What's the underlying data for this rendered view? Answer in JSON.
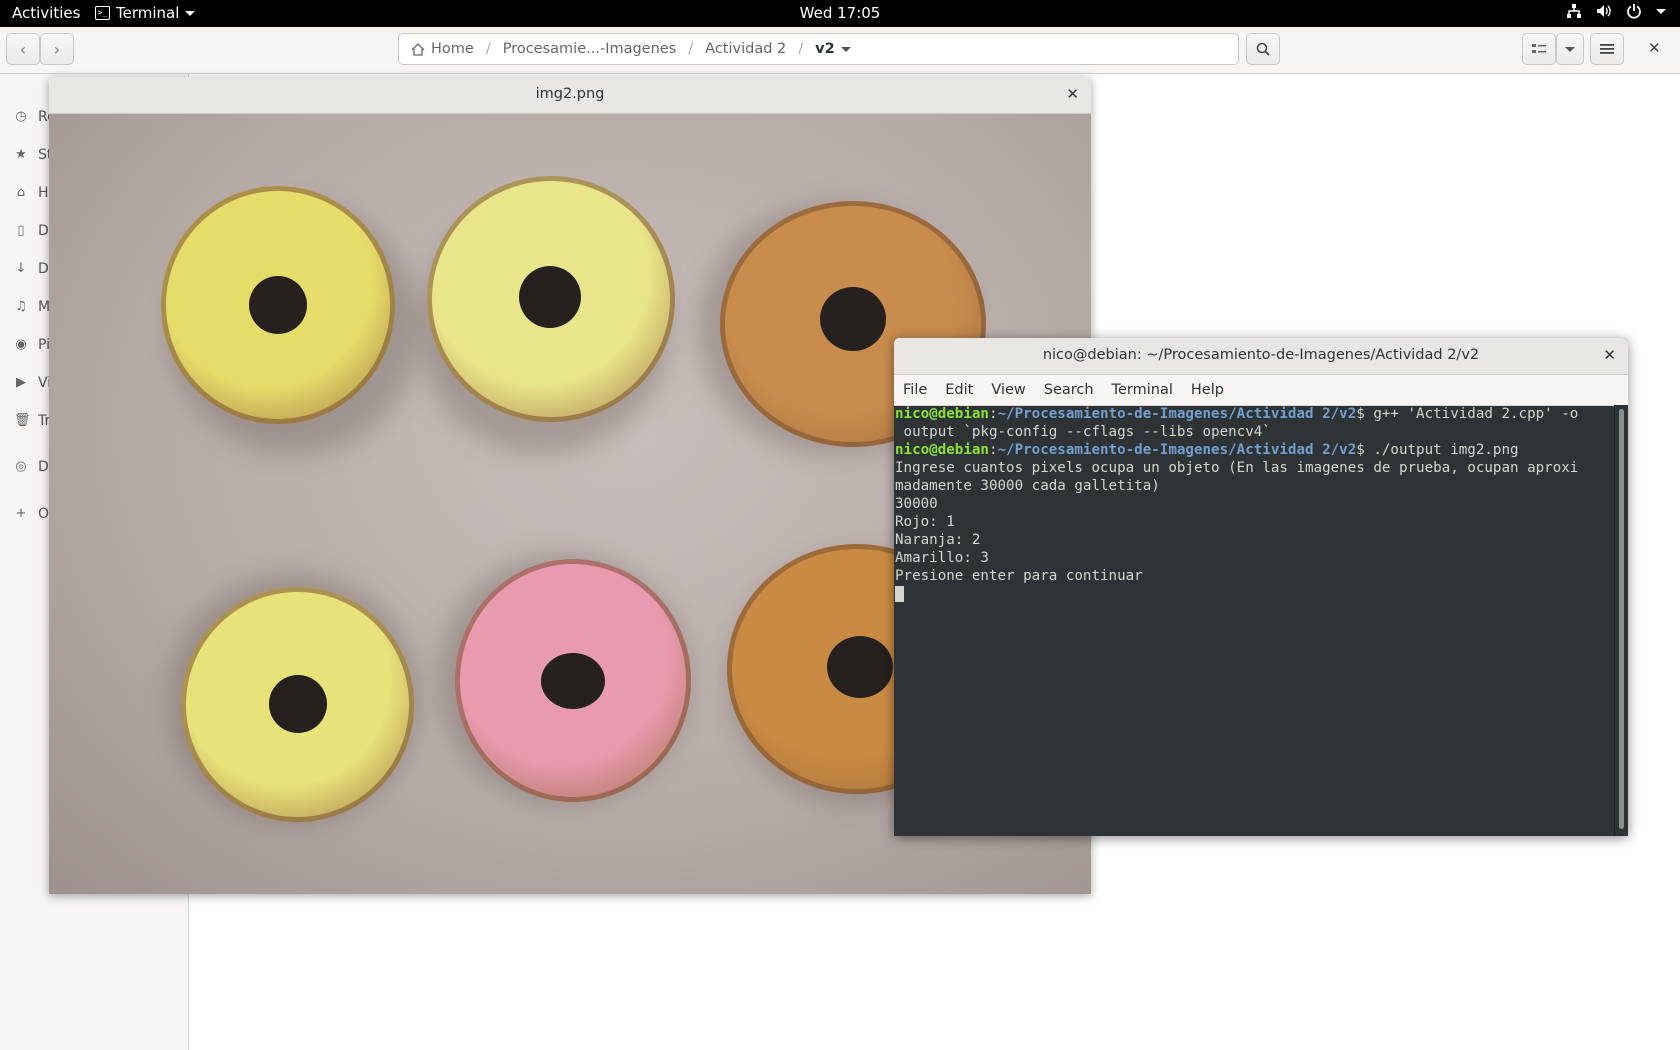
{
  "topbar": {
    "activities": "Activities",
    "app_name": "Terminal",
    "clock": "Wed 17:05"
  },
  "files": {
    "path": [
      "Home",
      "Procesamie...-Imagenes",
      "Actividad 2",
      "v2"
    ],
    "sidebar_items": [
      {
        "label": "Re",
        "icon": "clock-icon"
      },
      {
        "label": "St",
        "icon": "star-icon"
      },
      {
        "label": "H",
        "icon": "home-icon"
      },
      {
        "label": "D",
        "icon": "document-icon"
      },
      {
        "label": "D",
        "icon": "download-icon"
      },
      {
        "label": "M",
        "icon": "music-icon"
      },
      {
        "label": "Pi",
        "icon": "camera-icon"
      },
      {
        "label": "Vi",
        "icon": "video-icon"
      },
      {
        "label": "Tr",
        "icon": "trash-icon"
      },
      {
        "label": "D",
        "icon": "disc-icon"
      },
      {
        "label": "O",
        "icon": "plus-icon"
      }
    ]
  },
  "viewer": {
    "title": "img2.png",
    "donuts": [
      {
        "color": "#e6dc6a"
      },
      {
        "color": "#e9e58a"
      },
      {
        "color": "#c88c4c"
      },
      {
        "color": "#e8e27a"
      },
      {
        "color": "#e89aae"
      },
      {
        "color": "#c98a43"
      }
    ]
  },
  "terminal": {
    "title": "nico@debian: ~/Procesamiento-de-Imagenes/Actividad 2/v2",
    "menu": [
      "File",
      "Edit",
      "View",
      "Search",
      "Terminal",
      "Help"
    ],
    "user_host": "nico@debian",
    "cwd": "~/Procesamiento-de-Imagenes/Actividad 2/v2",
    "cmd1": "$ g++ 'Actividad 2.cpp' -o",
    "cmd1_cont": " output `pkg-config --cflags --libs opencv4`",
    "cmd2": "$ ./output img2.png",
    "output": [
      "Ingrese cuantos pixels ocupa un objeto (En las imagenes de prueba, ocupan aproxi",
      "madamente 30000 cada galletita)",
      "30000",
      "Rojo: 1",
      "Naranja: 2",
      "Amarillo: 3",
      "Presione enter para continuar"
    ]
  }
}
